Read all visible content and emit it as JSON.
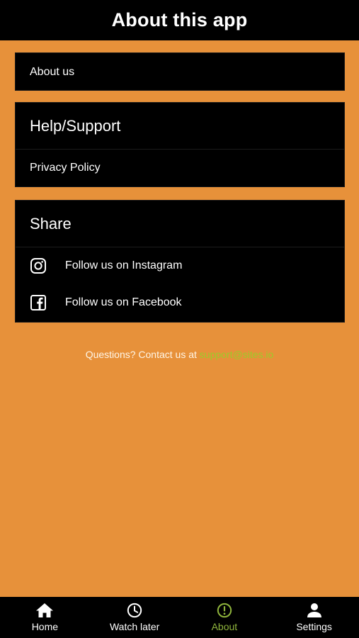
{
  "header": {
    "title": "About this app"
  },
  "about_card": {
    "about_us_label": "About us"
  },
  "help_card": {
    "title": "Help/Support",
    "privacy_label": "Privacy Policy"
  },
  "share_card": {
    "title": "Share",
    "instagram_label": "Follow us on Instagram",
    "facebook_label": "Follow us on Facebook"
  },
  "contact": {
    "text": "Questions? Contact us at ",
    "email": "support@sites.io"
  },
  "bottom_nav": {
    "items": [
      {
        "label": "Home",
        "icon": "home-icon"
      },
      {
        "label": "Watch later",
        "icon": "clock-icon"
      },
      {
        "label": "About",
        "icon": "info-icon",
        "active": true
      },
      {
        "label": "Settings",
        "icon": "person-icon"
      }
    ]
  },
  "colors": {
    "background": "#E7913A",
    "surface": "#000000",
    "accent": "#8FB43C",
    "email_link": "#9BCB2A"
  }
}
